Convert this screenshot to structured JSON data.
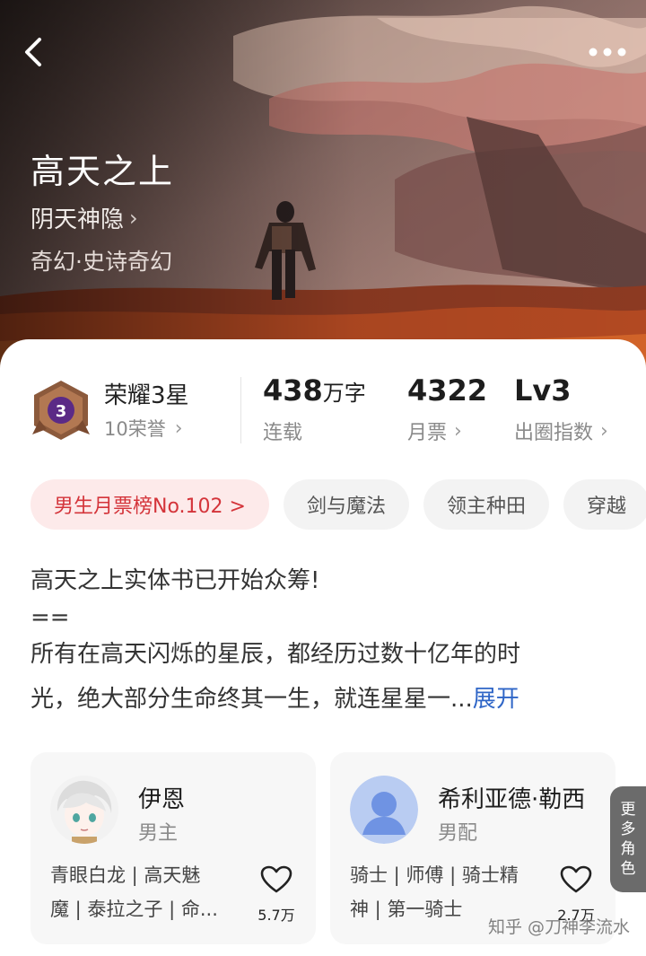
{
  "hero": {
    "title": "高天之上",
    "author": "阴天神隐",
    "genre": "奇幻·史诗奇幻"
  },
  "stats": {
    "honor": {
      "badge_number": "3",
      "title": "荣耀3星",
      "sub": "10荣誉"
    },
    "word_count": {
      "value": "438",
      "unit": "万字",
      "label": "连载"
    },
    "monthly_votes": {
      "value": "4322",
      "label": "月票"
    },
    "breakout_index": {
      "value": "Lv3",
      "label": "出圈指数"
    }
  },
  "tags": [
    "男生月票榜No.102 >",
    "剑与魔法",
    "领主种田",
    "穿越"
  ],
  "description": {
    "line1": "高天之上实体书已开始众筹!",
    "line2": "==",
    "line3": "所有在高天闪烁的星辰，都经历过数十亿年的时",
    "line4": "光，绝大部分生命终其一生，就连星星一...",
    "expand": "展开"
  },
  "characters": [
    {
      "name": "伊恩",
      "role": "男主",
      "tags_line1": "青眼白龙 | 高天魅",
      "tags_line2": "魔 | 泰拉之子 | 命...",
      "likes": "5.7万"
    },
    {
      "name": "希利亚德·勒西",
      "role": "男配",
      "tags_line1": "骑士 | 师傅 | 骑士精",
      "tags_line2": "神 | 第一骑士",
      "likes": "2.7万"
    }
  ],
  "more_characters": [
    "更",
    "多",
    "角",
    "色"
  ],
  "watermark": "知乎 @刀神李流水",
  "colors": {
    "rank_tag_bg": "#fdeaea",
    "rank_tag_text": "#d4343a",
    "expand_link": "#2f66c7",
    "badge": "#5b2a86"
  }
}
